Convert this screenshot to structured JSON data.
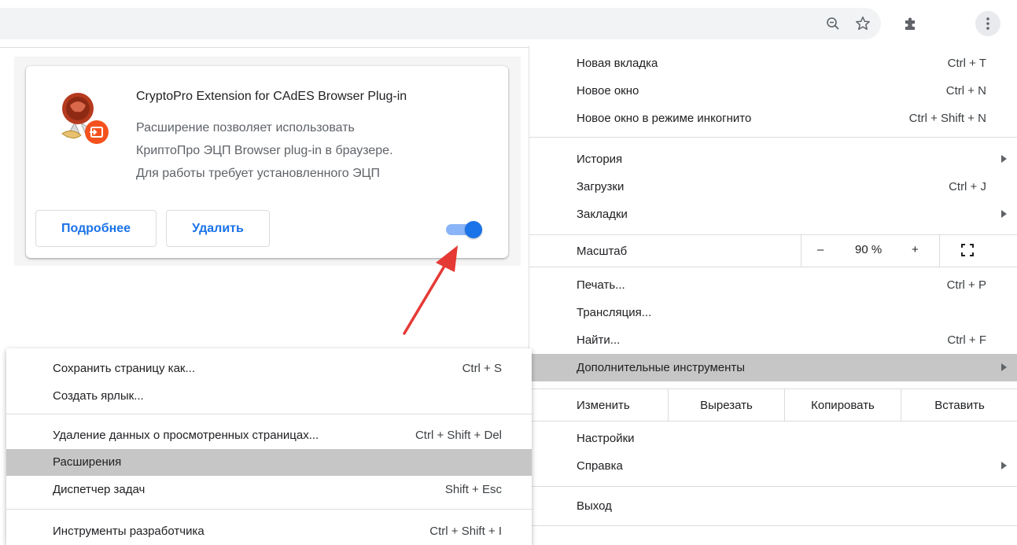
{
  "toolbar": {
    "zoom_icon": "zoom-out-magnifier-icon",
    "bookmark_icon": "star-icon",
    "extensions_icon": "puzzle-icon",
    "menu_icon": "kebab-menu-icon"
  },
  "extension": {
    "name": "CryptoPro Extension for CAdES Browser Plug-in",
    "description_lines": [
      "Расширение позволяет использовать",
      "КриптоПро ЭЦП Browser plug-in в браузере.",
      "Для работы требует установленного ЭЦП"
    ],
    "details_button": "Подробнее",
    "remove_button": "Удалить",
    "enabled": true,
    "accent_color": "#1a73e8"
  },
  "main_menu": {
    "new_tab": {
      "label": "Новая вкладка",
      "shortcut": "Ctrl + T"
    },
    "new_window": {
      "label": "Новое окно",
      "shortcut": "Ctrl + N"
    },
    "incognito": {
      "label": "Новое окно в режиме инкогнито",
      "shortcut": "Ctrl + Shift + N"
    },
    "history": {
      "label": "История"
    },
    "downloads": {
      "label": "Загрузки",
      "shortcut": "Ctrl + J"
    },
    "bookmarks": {
      "label": "Закладки"
    },
    "zoom": {
      "label": "Масштаб",
      "minus": "–",
      "value": "90 %",
      "plus": "+"
    },
    "print": {
      "label": "Печать...",
      "shortcut": "Ctrl + P"
    },
    "cast": {
      "label": "Трансляция..."
    },
    "find": {
      "label": "Найти...",
      "shortcut": "Ctrl + F"
    },
    "more_tools": {
      "label": "Дополнительные инструменты"
    },
    "edit": {
      "label": "Изменить",
      "cut": "Вырезать",
      "copy": "Копировать",
      "paste": "Вставить"
    },
    "settings": {
      "label": "Настройки"
    },
    "help": {
      "label": "Справка"
    },
    "exit": {
      "label": "Выход"
    }
  },
  "sub_menu": {
    "save_page": {
      "label": "Сохранить страницу как...",
      "shortcut": "Ctrl + S"
    },
    "create_shortcut": {
      "label": "Создать ярлык..."
    },
    "clear_data": {
      "label": "Удаление данных о просмотренных страницах...",
      "shortcut": "Ctrl + Shift + Del"
    },
    "extensions": {
      "label": "Расширения"
    },
    "task_manager": {
      "label": "Диспетчер задач",
      "shortcut": "Shift + Esc"
    },
    "dev_tools": {
      "label": "Инструменты разработчика",
      "shortcut": "Ctrl + Shift + I"
    }
  },
  "colors": {
    "highlight": "#c6c6c6",
    "annotation_arrow": "#e53935"
  }
}
